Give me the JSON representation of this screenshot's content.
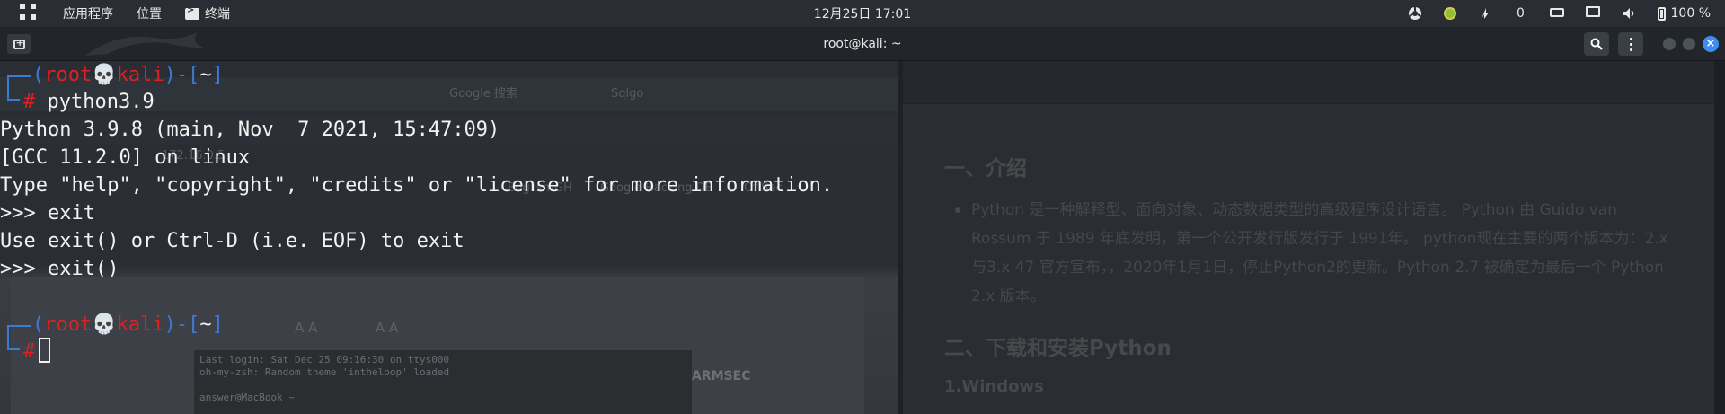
{
  "topbar": {
    "apps_menu": "应用程序",
    "places_menu": "位置",
    "terminal_menu": "终端",
    "clock": "12月25日 17:01",
    "notification_count": "0",
    "battery_percent": "100 %"
  },
  "window": {
    "title": "root@kali: ~"
  },
  "terminal": {
    "prompt_user": "root",
    "prompt_skull": "💀",
    "prompt_host": "kali",
    "prompt_dir": "~",
    "prompt_symbol": "#",
    "command_1": "python3.9",
    "output": [
      "Python 3.9.8 (main, Nov  7 2021, 15:47:09)",
      "[GCC 11.2.0] on linux",
      "Type \"help\", \"copyright\", \"credits\" or \"license\" for more information.",
      ">>> exit",
      "Use exit() or Ctrl-D (i.e. EOF) to exit",
      ">>> exit()"
    ]
  },
  "background": {
    "tabs": [
      "Google 搜索",
      "Sqlgo"
    ],
    "url": "172.16.0.5",
    "bookmarks": [
      "English-GH",
      "Google Hacking DB",
      "OffSec"
    ],
    "inner_lines": [
      "Last login: Sat Dec 25 09:16:30 on ttys000",
      "oh-my-zsh: Random theme 'intheloop' loaded",
      "answer@MacBook ~"
    ],
    "font_size_labels": [
      "A A",
      "A A"
    ],
    "brand": "ARMSEC"
  },
  "document": {
    "heading_1": "一、介绍",
    "paragraph": "Python 是一种解释型、面向对象、动态数据类型的高级程序设计语言。 Python 由 Guido van Rossum 于 1989 年底发明，第一个公开发行版发行于 1991年。 python现在主要的两个版本为：2.x与3.x 47 官方宣布，，2020年1月1日，停止Python2的更新。Python 2.7 被确定为最后一个 Python 2.x 版本。",
    "heading_2": "二、下载和安装Python",
    "subheading": "1.Windows"
  }
}
